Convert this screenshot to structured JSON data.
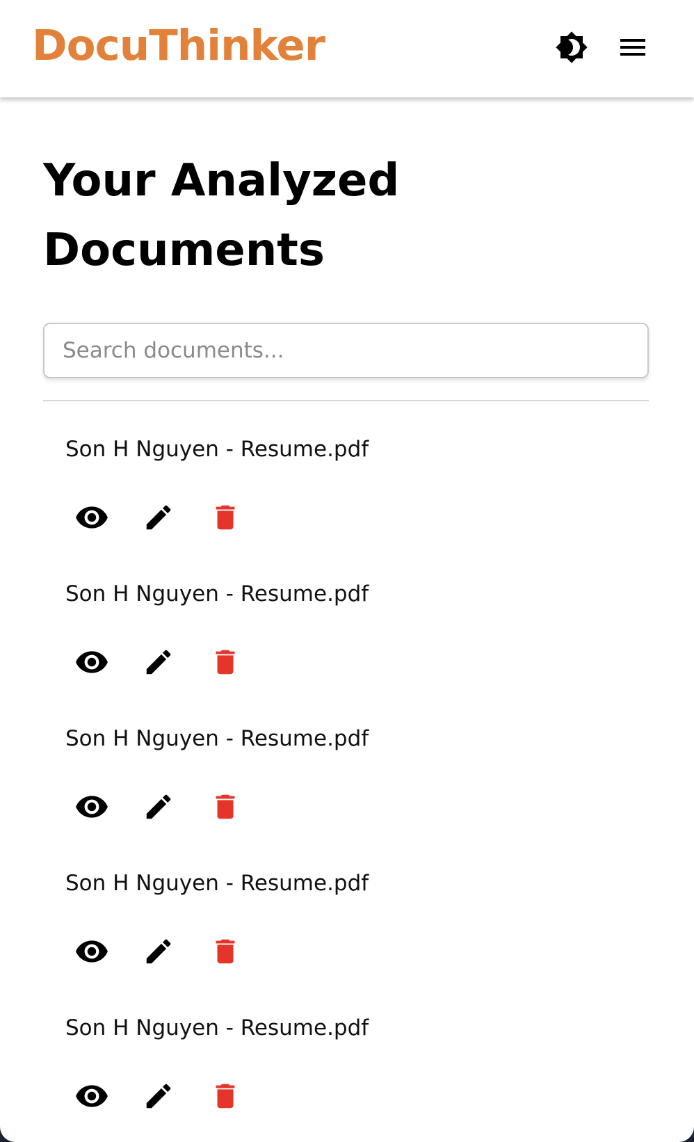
{
  "app": {
    "brand": "DocuThinker",
    "brand_color": "#e2823a"
  },
  "header": {
    "theme_toggle_icon": "brightness-contrast-icon",
    "menu_icon": "hamburger-menu-icon"
  },
  "main": {
    "title": "Your Analyzed Documents",
    "search": {
      "placeholder": "Search documents...",
      "value": ""
    },
    "documents": [
      {
        "name": "Son H Nguyen - Resume.pdf"
      },
      {
        "name": "Son H Nguyen - Resume.pdf"
      },
      {
        "name": "Son H Nguyen - Resume.pdf"
      },
      {
        "name": "Son H Nguyen - Resume.pdf"
      },
      {
        "name": "Son H Nguyen - Resume.pdf"
      }
    ],
    "action_icons": [
      "eye-icon",
      "pencil-icon",
      "trash-icon"
    ],
    "delete_color": "#e5352b"
  }
}
